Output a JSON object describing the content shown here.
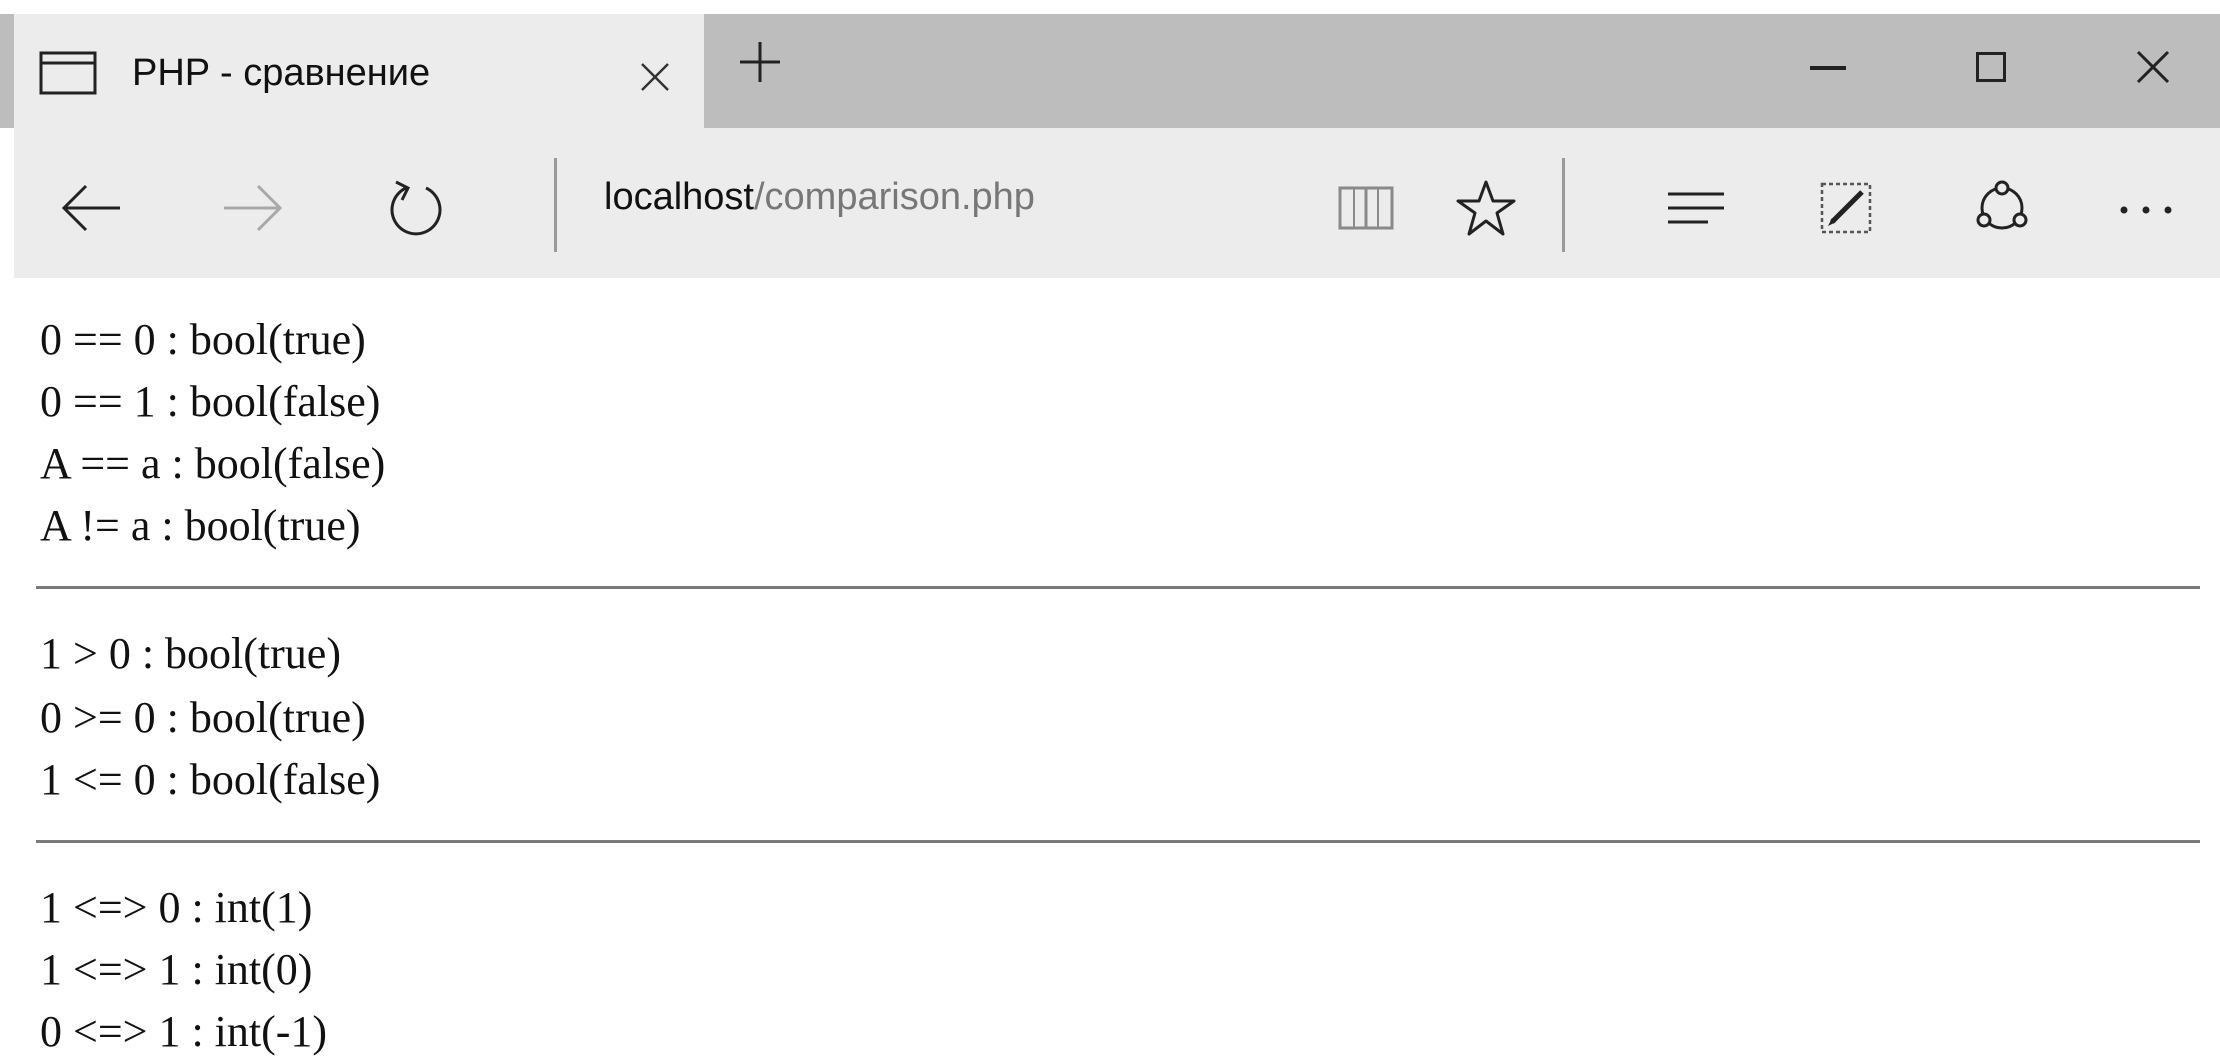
{
  "browser": {
    "tab": {
      "title": "PHP - сравнение"
    },
    "address": {
      "host": "localhost",
      "path": "/comparison.php"
    }
  },
  "page": {
    "equality": [
      "0 == 0 : bool(true)",
      "0 == 1 : bool(false)",
      "A == a : bool(false)",
      "A != a : bool(true)"
    ],
    "ordering": [
      "1 > 0 : bool(true)",
      "0 >= 0 : bool(true)",
      "1 <= 0 : bool(false)"
    ],
    "spaceship": [
      "1 <=> 0 : int(1)",
      "1 <=> 1 : int(0)",
      "0 <=> 1 : int(-1)"
    ]
  }
}
